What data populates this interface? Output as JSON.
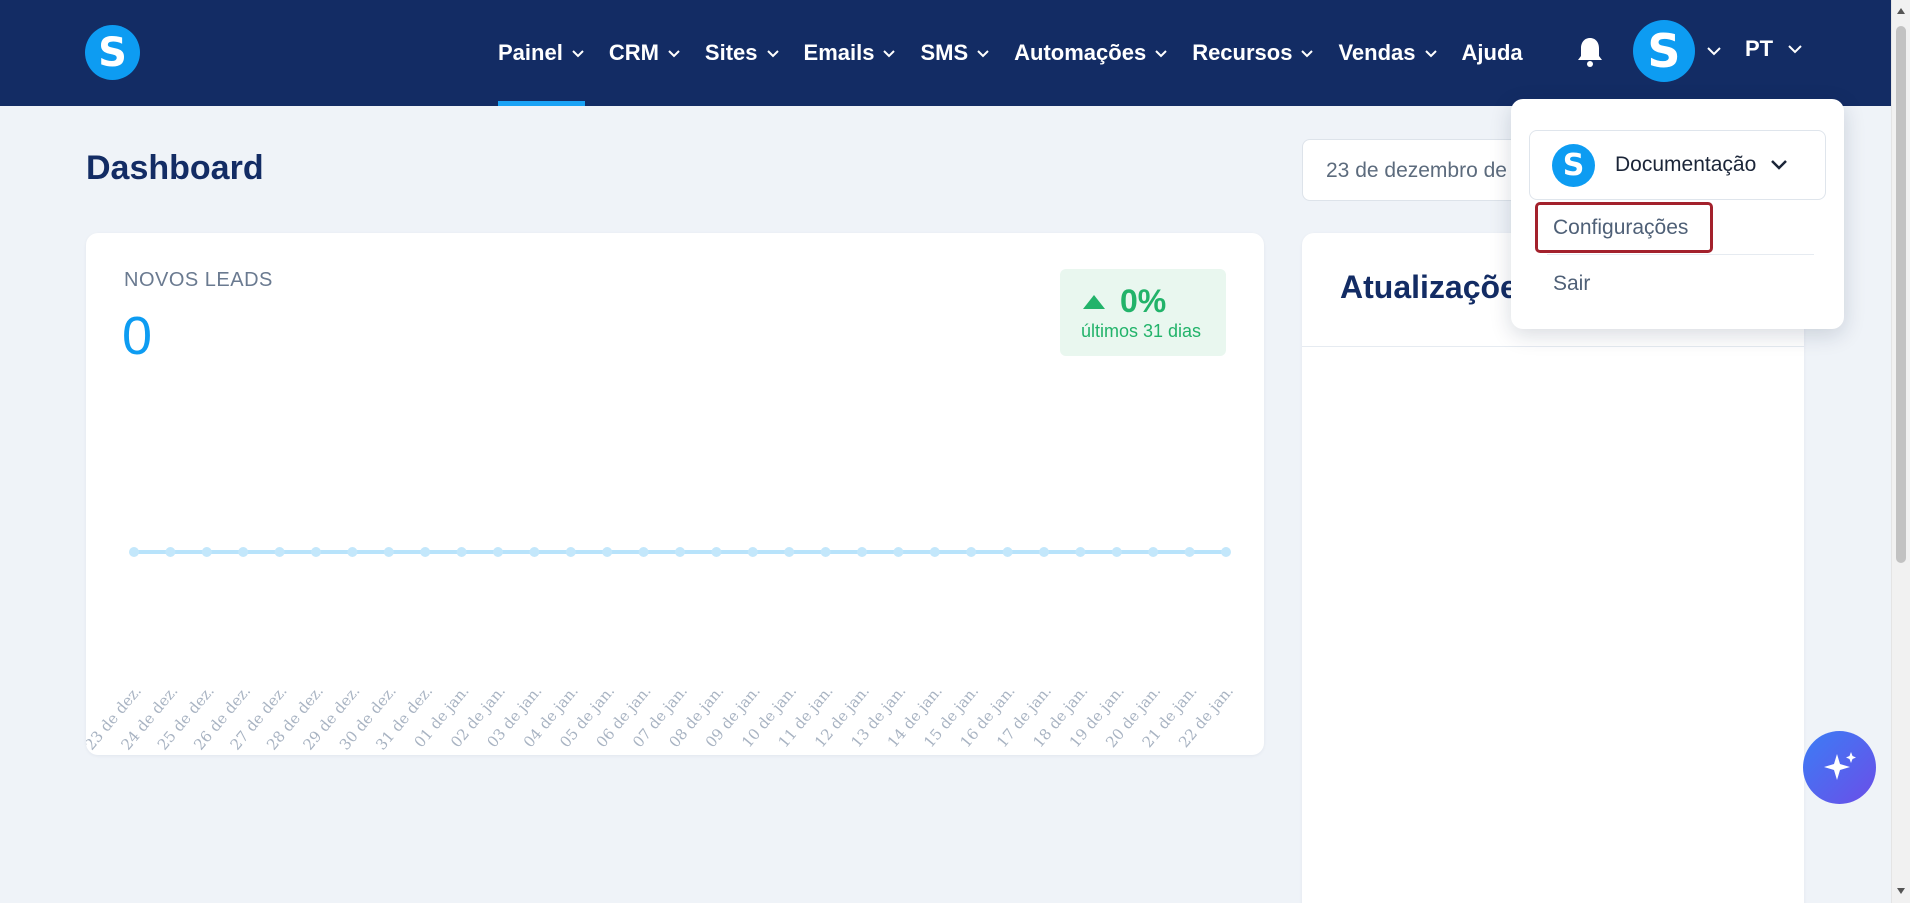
{
  "header": {
    "logo_letter": "S",
    "nav": [
      {
        "label": "Painel",
        "active": true
      },
      {
        "label": "CRM"
      },
      {
        "label": "Sites"
      },
      {
        "label": "Emails"
      },
      {
        "label": "SMS"
      },
      {
        "label": "Automações"
      },
      {
        "label": "Recursos"
      },
      {
        "label": "Vendas"
      }
    ],
    "help_label": "Ajuda",
    "avatar_letter": "S",
    "language": "PT",
    "icons": {
      "bell": "bell-icon",
      "chevron": "chevron-down-icon"
    }
  },
  "page": {
    "title": "Dashboard",
    "date_range": "23 de dezembro de"
  },
  "leads_card": {
    "label": "NOVOS LEADS",
    "value": "0",
    "change": "0%",
    "change_period": "últimos 31 dias",
    "change_color": "#22b36a"
  },
  "chart_data": {
    "type": "line",
    "categories": [
      "23 de dez.",
      "24 de dez.",
      "25 de dez.",
      "26 de dez.",
      "27 de dez.",
      "28 de dez.",
      "29 de dez.",
      "30 de dez.",
      "31 de dez.",
      "01 de jan.",
      "02 de jan.",
      "03 de jan.",
      "04 de jan.",
      "05 de jan.",
      "06 de jan.",
      "07 de jan.",
      "08 de jan.",
      "09 de jan.",
      "10 de jan.",
      "11 de jan.",
      "12 de jan.",
      "13 de jan.",
      "14 de jan.",
      "15 de jan.",
      "16 de jan.",
      "17 de jan.",
      "18 de jan.",
      "19 de jan.",
      "20 de jan.",
      "21 de jan.",
      "22 de jan."
    ],
    "values": [
      0,
      0,
      0,
      0,
      0,
      0,
      0,
      0,
      0,
      0,
      0,
      0,
      0,
      0,
      0,
      0,
      0,
      0,
      0,
      0,
      0,
      0,
      0,
      0,
      0,
      0,
      0,
      0,
      0,
      0,
      0
    ],
    "color": "#b8e3fb"
  },
  "updates_card": {
    "title": "Atualizações"
  },
  "dropdown": {
    "account_logo_letter": "S",
    "account_name": "Documentação",
    "items": [
      "Configurações",
      "Sair"
    ],
    "highlight_color": "#a3212c"
  },
  "ai_button": {
    "icon": "sparkle-icon"
  },
  "colors": {
    "navbar": "#132c64",
    "accent": "#0d9cf2",
    "background": "#eff3f8"
  }
}
